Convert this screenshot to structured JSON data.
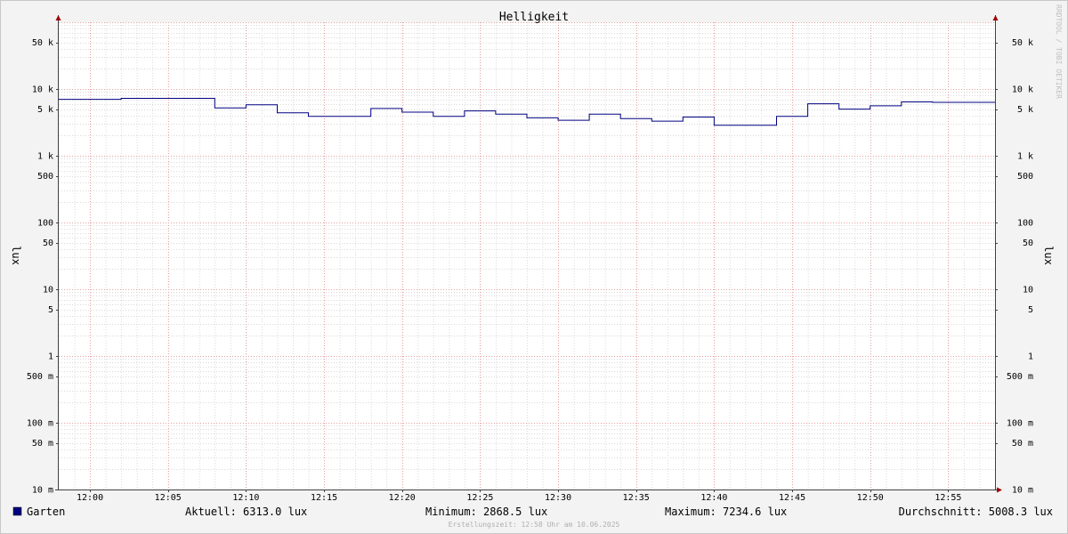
{
  "chart_data": {
    "type": "line",
    "title": "Helligkeit",
    "ylabel": "lux",
    "ylabel_right": "lux",
    "y_scale": "log",
    "ylim": [
      0.01,
      100000
    ],
    "xlim": [
      "11:58",
      "12:58"
    ],
    "x_ticks": [
      "12:00",
      "12:05",
      "12:10",
      "12:15",
      "12:20",
      "12:25",
      "12:30",
      "12:35",
      "12:40",
      "12:45",
      "12:50",
      "12:55"
    ],
    "y_ticks": [
      {
        "value": 50000,
        "label": "50 k"
      },
      {
        "value": 10000,
        "label": "10 k"
      },
      {
        "value": 5000,
        "label": "5 k"
      },
      {
        "value": 1000,
        "label": "1 k"
      },
      {
        "value": 500,
        "label": "500"
      },
      {
        "value": 100,
        "label": "100"
      },
      {
        "value": 50,
        "label": "50"
      },
      {
        "value": 10,
        "label": "10"
      },
      {
        "value": 5,
        "label": "5"
      },
      {
        "value": 1,
        "label": "1"
      },
      {
        "value": 0.5,
        "label": "500 m"
      },
      {
        "value": 0.1,
        "label": "100 m"
      },
      {
        "value": 0.05,
        "label": "50 m"
      },
      {
        "value": 0.01,
        "label": "10 m"
      }
    ],
    "grid": true,
    "series": [
      {
        "name": "Garten",
        "color": "#000080",
        "step": true,
        "x": [
          "11:58",
          "12:02",
          "12:08",
          "12:10",
          "12:12",
          "12:14",
          "12:18",
          "12:20",
          "12:22",
          "12:24",
          "12:26",
          "12:28",
          "12:30",
          "12:32",
          "12:34",
          "12:36",
          "12:38",
          "12:40",
          "12:44",
          "12:46",
          "12:48",
          "12:50",
          "12:52",
          "12:54",
          "12:58"
        ],
        "values": [
          7000,
          7234.6,
          5200,
          5800,
          4400,
          3900,
          5100,
          4500,
          3900,
          4700,
          4200,
          3700,
          3400,
          4200,
          3600,
          3300,
          3800,
          2868.5,
          3900,
          6000,
          5000,
          5600,
          6400,
          6313,
          6313
        ]
      }
    ],
    "legend": {
      "position": "bottom",
      "label": "Garten",
      "color": "#000080",
      "current": "Aktuell: 6313.0 lux",
      "minimum": "Minimum: 2868.5 lux",
      "maximum": "Maximum: 7234.6 lux",
      "average": "Durchschnitt: 5008.3 lux"
    },
    "footer": "Erstellungszeit: 12:58 Uhr am 10.06.2025",
    "watermark": "RRDTOOL / TOBI OETIKER"
  }
}
